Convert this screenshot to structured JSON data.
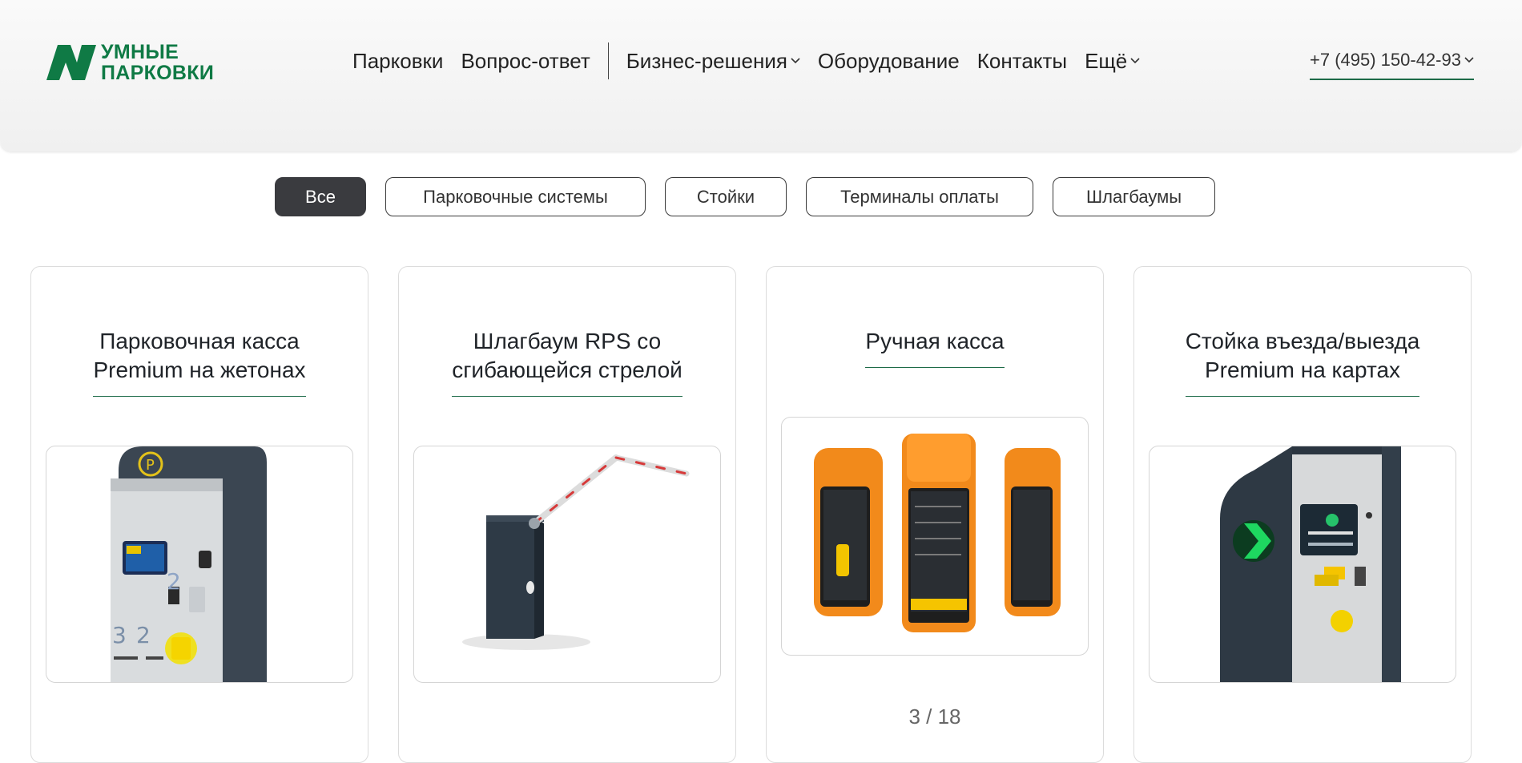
{
  "logo": {
    "line1": "УМНЫЕ",
    "line2": "ПАРКОВКИ",
    "brand_color": "#0f7a45"
  },
  "nav": {
    "items": [
      "Парковки",
      "Вопрос-ответ",
      "Бизнес-решения",
      "Оборудование",
      "Контакты",
      "Ещё"
    ],
    "phone": "+7 (495) 150-42-93"
  },
  "filters": [
    "Все",
    "Парковочные системы",
    "Стойки",
    "Терминалы оплаты",
    "Шлагбаумы"
  ],
  "active_filter": "Все",
  "cards": [
    {
      "title_l1": "Парковочная касса",
      "title_l2": "Premium на жетонах"
    },
    {
      "title_l1": "Шлагбаум RPS со",
      "title_l2": "сгибающейся стрелой"
    },
    {
      "title_l1": "Ручная касса",
      "counter": "3 / 18"
    },
    {
      "title_l1": "Стойка въезда/выезда",
      "title_l2": "Premium на картах"
    }
  ],
  "colors": {
    "accent": "#1d6b48",
    "chip_active_bg": "#3a3b3f"
  }
}
